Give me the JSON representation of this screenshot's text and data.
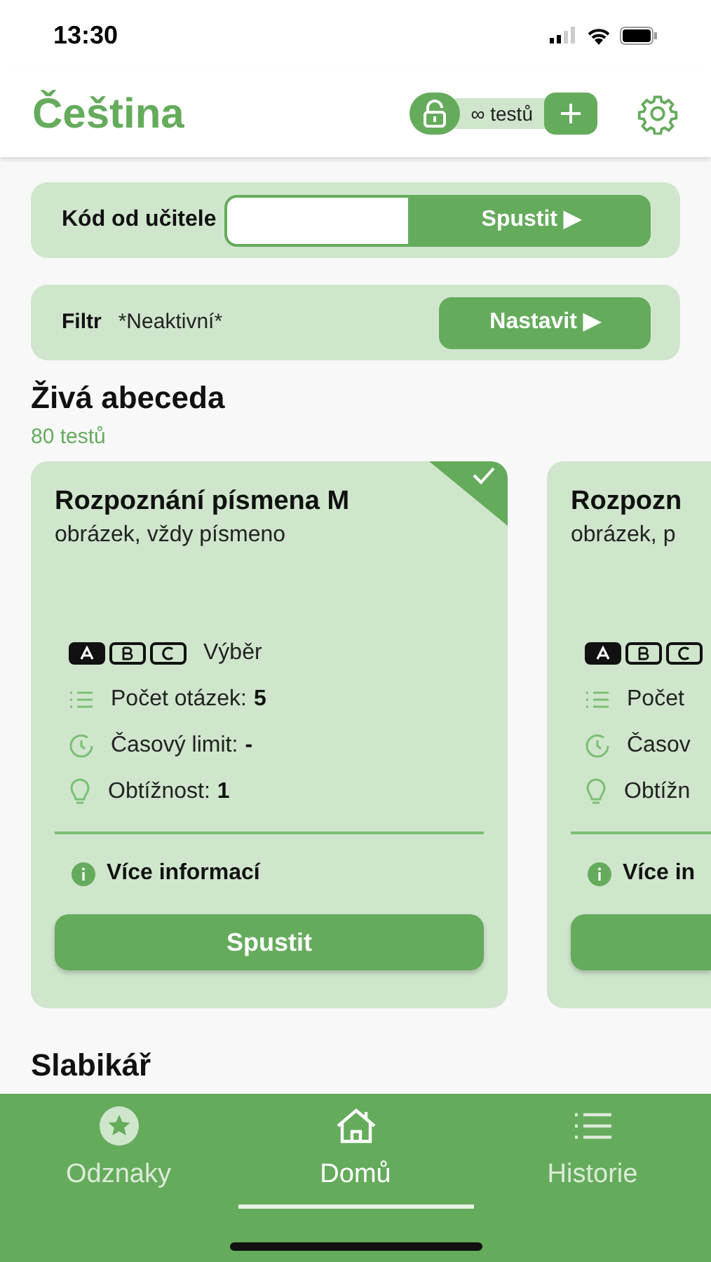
{
  "status_bar": {
    "time": "13:30"
  },
  "header": {
    "title": "Čeština",
    "tests_badge": "∞ testů"
  },
  "teacher_code": {
    "label": "Kód od učitele",
    "button": "Spustit ▶"
  },
  "filter": {
    "label": "Filtr",
    "value": "*Neaktivní*",
    "button": "Nastavit ▶"
  },
  "section": {
    "title": "Živá abeceda",
    "count": "80 testů"
  },
  "cards": [
    {
      "completed": true,
      "title": "Rozpoznání písmena M",
      "subtitle": "obrázek, vždy písmeno",
      "mode": "Výběr",
      "questions_label": "Počet otázek:",
      "questions_value": "5",
      "time_label": "Časový limit:",
      "time_value": "-",
      "difficulty_label": "Obtížnost:",
      "difficulty_value": "1",
      "info": "Více informací",
      "button": "Spustit"
    },
    {
      "completed": false,
      "title": "Rozpozn",
      "subtitle": "obrázek, p",
      "questions_label": "Počet",
      "time_label": "Časov",
      "difficulty_label": "Obtížn",
      "info": "Více in"
    }
  ],
  "next_section": {
    "title": "Slabikář"
  },
  "tabs": [
    {
      "label": "Odznaky",
      "selected": false
    },
    {
      "label": "Domů",
      "selected": true
    },
    {
      "label": "Historie",
      "selected": false
    }
  ]
}
